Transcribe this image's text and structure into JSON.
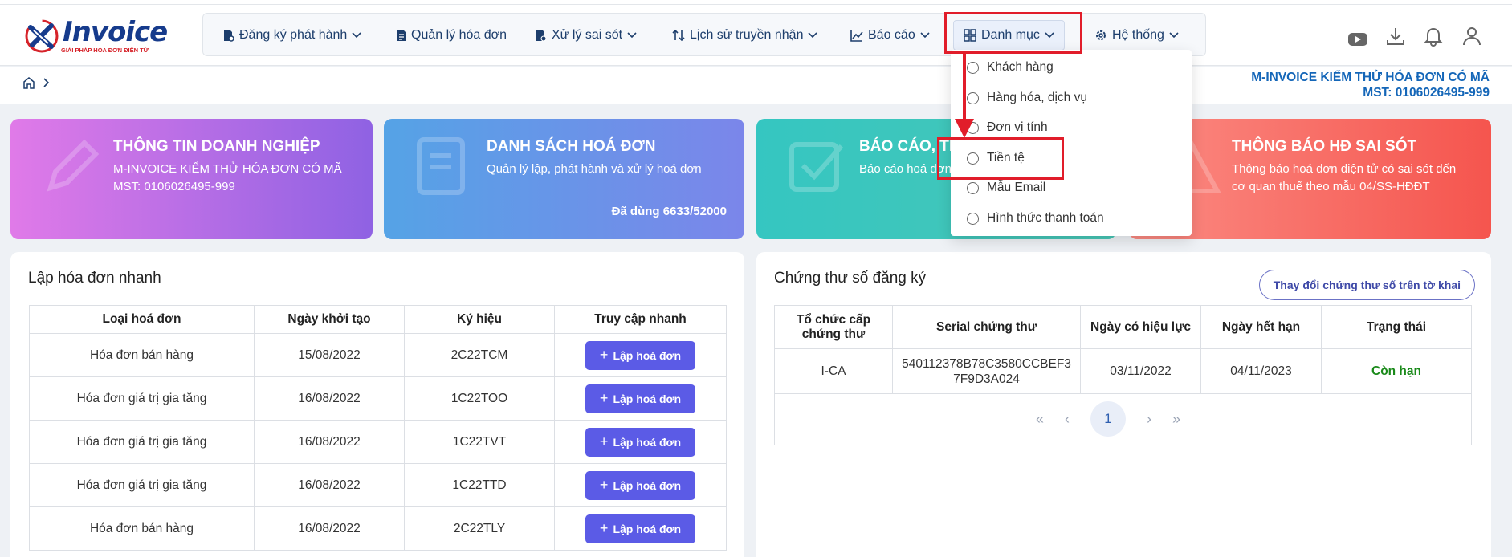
{
  "header": {
    "logo": {
      "brand": "Invoice",
      "tagline": "GIẢI PHÁP HÓA ĐƠN ĐIỆN TỬ"
    },
    "nav": [
      {
        "label": "Đăng ký phát hành",
        "icon": "file-sign-icon",
        "has_caret": true
      },
      {
        "label": "Quản lý hóa đơn",
        "icon": "document-icon",
        "has_caret": false
      },
      {
        "label": "Xử lý sai sót",
        "icon": "file-error-icon",
        "has_caret": true
      },
      {
        "label": "Lịch sử truyền nhận",
        "icon": "transfer-arrows-icon",
        "has_caret": true
      },
      {
        "label": "Báo cáo",
        "icon": "chart-line-icon",
        "has_caret": true
      },
      {
        "label": "Danh mục",
        "icon": "grid-icon",
        "has_caret": true
      },
      {
        "label": "Hệ thống",
        "icon": "gear-icon",
        "has_caret": true
      }
    ],
    "right_icons": [
      "youtube-icon",
      "download-icon",
      "bell-icon",
      "user-icon"
    ]
  },
  "dropdown": {
    "items": [
      "Khách hàng",
      "Hàng hóa, dịch vụ",
      "Đơn vị tính",
      "Tiền tệ",
      "Mẫu Email",
      "Hình thức thanh toán"
    ],
    "highlighted": "Tiền tệ"
  },
  "company": {
    "name": "M-INVOICE KIỂM THỬ HÓA ĐƠN CÓ MÃ",
    "tax_code": "MST: 0106026495-999"
  },
  "cards": [
    {
      "title": "THÔNG TIN DOANH NGHIỆP",
      "line1": "M-INVOICE KIỂM THỬ HÓA ĐƠN CÓ MÃ",
      "line2": "MST: 0106026495-999",
      "icon": "pencil-icon"
    },
    {
      "title": "DANH SÁCH HOÁ ĐƠN",
      "line1": "Quản lý lập, phát hành và xử lý hoá đơn",
      "footer": "Đã dùng 6633/52000",
      "icon": "book-icon"
    },
    {
      "title": "BÁO CÁO, TH",
      "line1": "Báo cáo hoá đơn",
      "icon": "checkbox-icon"
    },
    {
      "title": "THÔNG BÁO HĐ SAI SÓT",
      "line1": "Thông báo hoá đơn điện tử có sai sót đến",
      "line2": "cơ quan thuế theo mẫu 04/SS-HĐĐT",
      "icon": "warning-icon"
    }
  ],
  "quick_invoice": {
    "title": "Lập hóa đơn nhanh",
    "columns": [
      "Loại hoá đơn",
      "Ngày khởi tạo",
      "Ký hiệu",
      "Truy cập nhanh"
    ],
    "button_label": "Lập hoá đơn",
    "rows": [
      {
        "type": "Hóa đơn bán hàng",
        "date": "15/08/2022",
        "code": "2C22TCM"
      },
      {
        "type": "Hóa đơn giá trị gia tăng",
        "date": "16/08/2022",
        "code": "1C22TOO"
      },
      {
        "type": "Hóa đơn giá trị gia tăng",
        "date": "16/08/2022",
        "code": "1C22TVT"
      },
      {
        "type": "Hóa đơn giá trị gia tăng",
        "date": "16/08/2022",
        "code": "1C22TTD"
      },
      {
        "type": "Hóa đơn bán hàng",
        "date": "16/08/2022",
        "code": "2C22TLY"
      }
    ]
  },
  "certificates": {
    "title": "Chứng thư số đăng ký",
    "change_button": "Thay đổi chứng thư số trên tờ khai",
    "columns": [
      "Tổ chức cấp chứng thư",
      "Serial chứng thư",
      "Ngày có hiệu lực",
      "Ngày hết hạn",
      "Trạng thái"
    ],
    "rows": [
      {
        "issuer": "I-CA",
        "serial": "540112378B78C3580CCBEF37F9D3A024",
        "valid_from": "03/11/2022",
        "expires": "04/11/2023",
        "status": "Còn hạn"
      }
    ],
    "pagination": {
      "first": "«",
      "prev": "‹",
      "current": "1",
      "next": "›",
      "last": "»"
    }
  },
  "colors": {
    "primary_text": "#1d3e6c",
    "button": "#5b5be6",
    "highlight": "#e11d2a",
    "status_ok": "#1a8a1a"
  }
}
